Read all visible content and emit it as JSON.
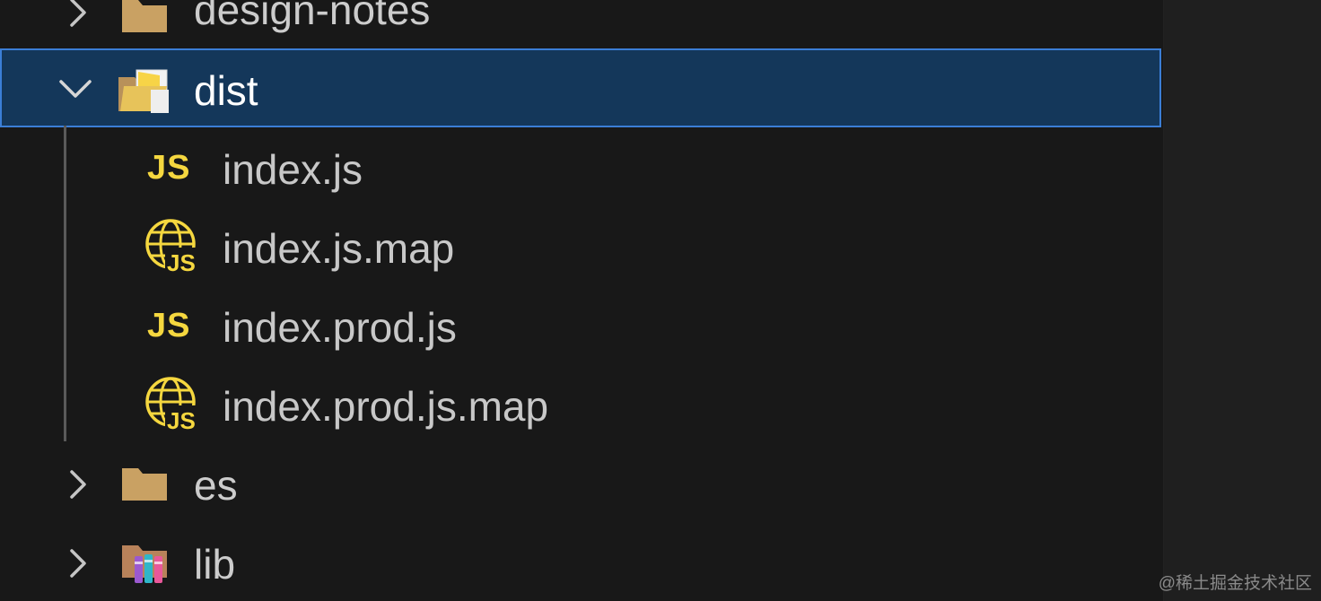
{
  "explorer": {
    "items": [
      {
        "label": "design-notes",
        "type": "folder",
        "expanded": false
      },
      {
        "label": "dist",
        "type": "folder",
        "expanded": true,
        "selected": true
      },
      {
        "label": "index.js",
        "type": "file",
        "icon": "js-icon"
      },
      {
        "label": "index.js.map",
        "type": "file",
        "icon": "js-map-globe-icon"
      },
      {
        "label": "index.prod.js",
        "type": "file",
        "icon": "js-icon"
      },
      {
        "label": "index.prod.js.map",
        "type": "file",
        "icon": "js-map-globe-icon"
      },
      {
        "label": "es",
        "type": "folder",
        "expanded": false
      },
      {
        "label": "lib",
        "type": "folder",
        "expanded": false,
        "icon": "library-folder-icon"
      }
    ],
    "js_badge": "JS",
    "map_badge": "JS"
  },
  "watermark": "@稀土掘金技术社区",
  "colors": {
    "background": "#181818",
    "selected_bg": "#14375a",
    "selected_border": "#3b7ed6",
    "folder": "#c9a163",
    "js_yellow": "#f5d73f"
  }
}
